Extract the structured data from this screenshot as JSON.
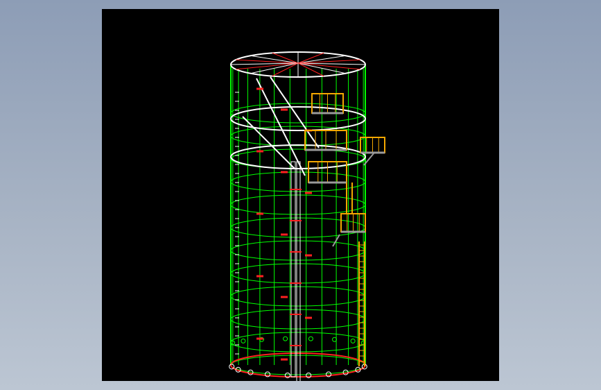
{
  "colors": {
    "background": "#8d9db6",
    "viewport": "#000000",
    "shell_lines": "#00ff00",
    "roof_and_rings": "#ffffff",
    "annotations": "#ff2020",
    "platforms": "#f5a800",
    "columns": "#ffffff",
    "braces": "#9a9a9a"
  },
  "drawing": {
    "subject": "cylindrical-tank-wireframe",
    "shell_rings": 11,
    "vertical_lines": 14,
    "platforms": 4,
    "ladder": "spiral"
  }
}
